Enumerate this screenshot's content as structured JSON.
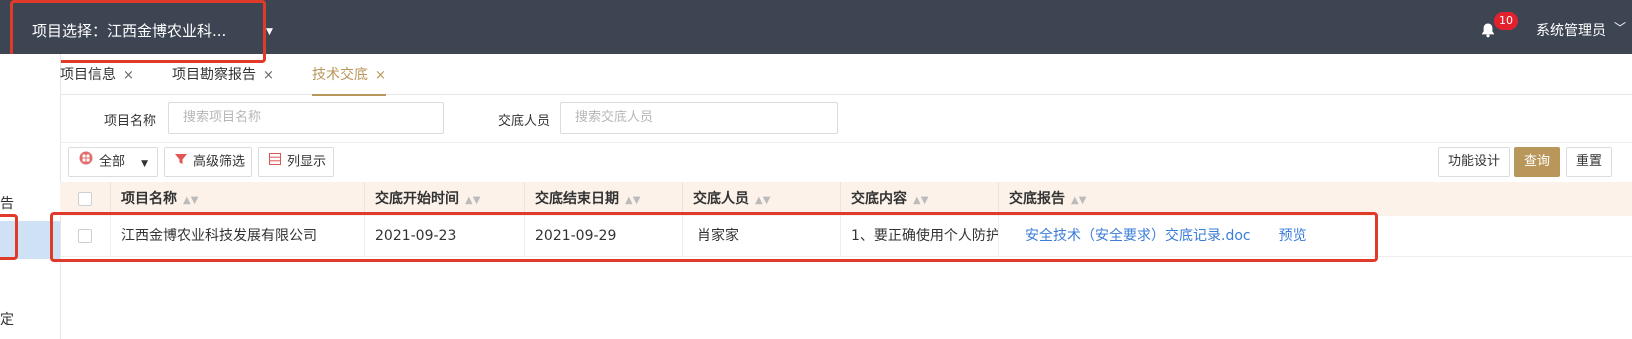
{
  "header": {
    "project_select": "项目选择：江西金博农业科...",
    "notification_count": "10",
    "user": "系统管理员"
  },
  "sidebar": {
    "item_partial_1": "告",
    "item_partial_2": "定"
  },
  "tabs": [
    {
      "label": "项目信息",
      "active": false
    },
    {
      "label": "项目勘察报告",
      "active": false
    },
    {
      "label": "技术交底",
      "active": true
    }
  ],
  "tab_close": "×",
  "filters": {
    "project_name_label": "项目名称",
    "project_name_placeholder": "搜索项目名称",
    "person_label": "交底人员",
    "person_placeholder": "搜索交底人员"
  },
  "toolbar": {
    "all_label": "全部",
    "advanced_filter": "高级筛选",
    "columns_display": "列显示",
    "function_design": "功能设计",
    "query": "查询",
    "reset": "重置"
  },
  "table": {
    "columns": [
      "项目名称",
      "交底开始时间",
      "交底结束日期",
      "交底人员",
      "交底内容",
      "交底报告"
    ],
    "rows": [
      {
        "project": "江西金博农业科技发展有限公司",
        "start": "2021-09-23",
        "end": "2021-09-29",
        "person": "肖家家",
        "content": "1、要正确使用个人防护",
        "report": "安全技术（安全要求）交底记录.doc",
        "preview": "预览"
      }
    ]
  },
  "colors": {
    "header_bg": "#3d4553",
    "accent": "#b9965a",
    "link": "#3b7dd8",
    "highlight": "#e03a2a"
  }
}
